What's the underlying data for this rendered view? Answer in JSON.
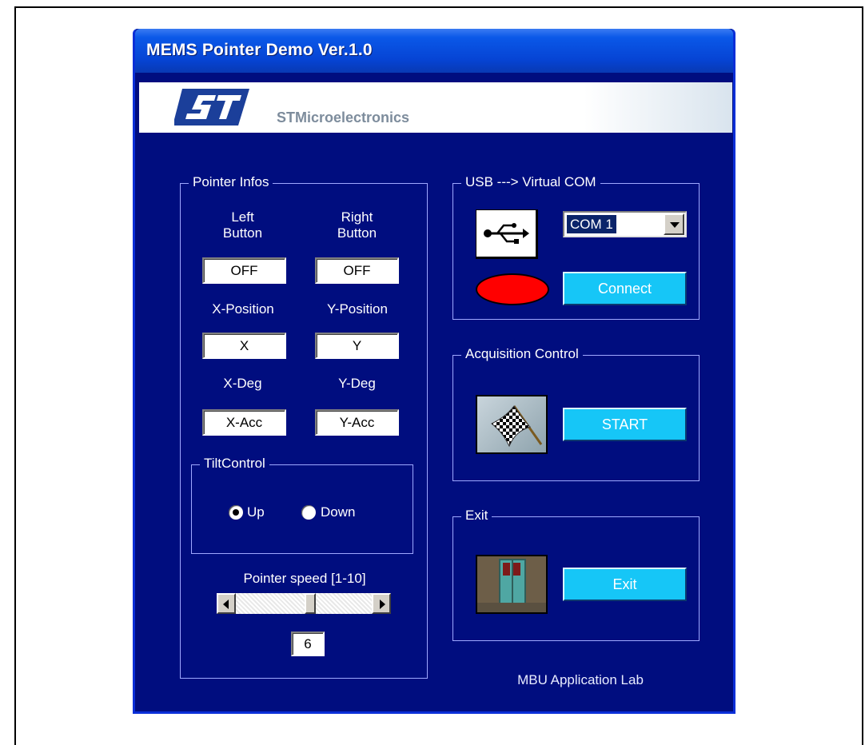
{
  "window": {
    "title": "MEMS Pointer Demo Ver.1.0"
  },
  "banner": {
    "company": "STMicroelectronics"
  },
  "pointer_infos": {
    "group_label": "Pointer Infos",
    "left_button_label": "Left\nButton",
    "right_button_label": "Right\nButton",
    "left_button_value": "OFF",
    "right_button_value": "OFF",
    "x_position_label": "X-Position",
    "y_position_label": "Y-Position",
    "x_position_value": "X",
    "y_position_value": "Y",
    "x_deg_label": "X-Deg",
    "y_deg_label": "Y-Deg",
    "x_deg_value": "X-Acc",
    "y_deg_value": "Y-Acc"
  },
  "tilt_control": {
    "group_label": "TiltControl",
    "options": [
      "Up",
      "Down"
    ],
    "selected": "Up"
  },
  "pointer_speed": {
    "label": "Pointer speed [1-10]",
    "value": "6",
    "level_fraction": 0.5
  },
  "usb": {
    "group_label": "USB ---> Virtual COM",
    "port": "COM 1",
    "connect_label": "Connect",
    "status_color": "#ff0000",
    "icon": "usb-icon"
  },
  "acquisition": {
    "group_label": "Acquisition Control",
    "start_label": "START",
    "icon": "checkered-flag-icon"
  },
  "exit": {
    "group_label": "Exit",
    "exit_label": "Exit",
    "icon": "door-icon"
  },
  "footer": {
    "lab": "MBU Application Lab"
  },
  "colors": {
    "window_bg": "#000d7f",
    "button": "#16c6f7",
    "titlebar": "#0a58e8"
  }
}
